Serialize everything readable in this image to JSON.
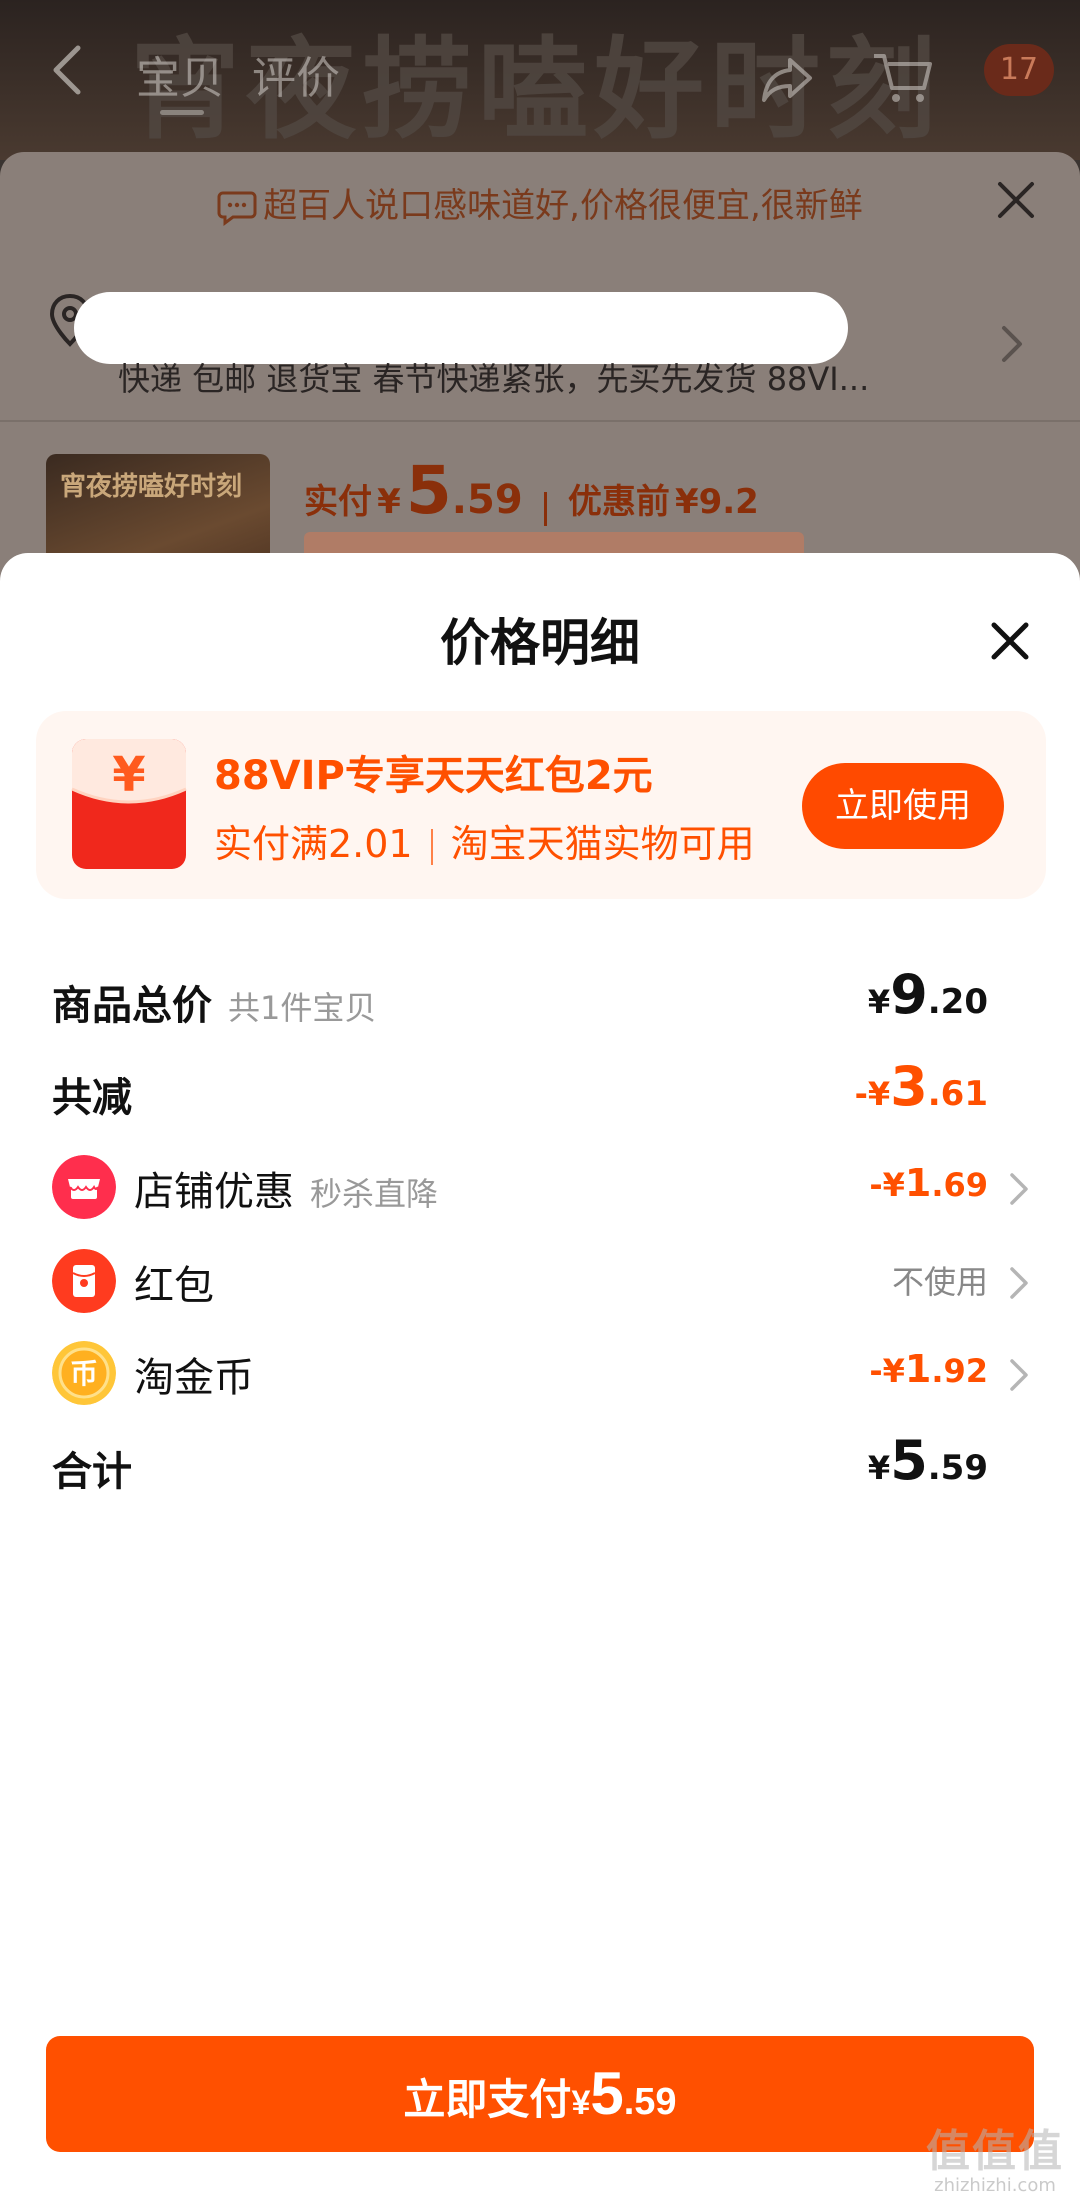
{
  "background": {
    "banner_text": "宵夜捞嗑好时刻",
    "nav": {
      "tab_baobei": "宝贝",
      "tab_pingjia": "评价",
      "cart_badge": "17"
    },
    "promo_text": "超百人说口感味道好,价格很便宜,很新鲜",
    "address_tags": "快递 包邮 退货宝 春节快递紧张，先买先发货 88VI...",
    "product_image_text": "宵夜捞嗑好时刻",
    "price": {
      "label": "实付",
      "currency": "¥",
      "int": "5",
      "dec": ".59",
      "before_label": "优惠前",
      "before_value": "¥9.2"
    }
  },
  "modal": {
    "title": "价格明细",
    "vip": {
      "title": "88VIP专享天天红包2元",
      "sub_left": "实付满2.01",
      "sub_right": "淘宝天猫实物可用",
      "button": "立即使用",
      "envelope_symbol": "¥"
    },
    "rows": {
      "total": {
        "label": "商品总价",
        "sub": "共1件宝贝",
        "cur": "¥",
        "int": "9",
        "dec": ".20"
      },
      "discount": {
        "label": "共减",
        "cur": "-¥",
        "int": "3",
        "dec": ".61"
      },
      "shop": {
        "label": "店铺优惠",
        "sub": "秒杀直降",
        "cur": "-¥",
        "int": "1",
        "dec": ".69"
      },
      "redpacket": {
        "label": "红包",
        "value": "不使用"
      },
      "coin": {
        "label": "淘金币",
        "cur": "-¥",
        "int": "1",
        "dec": ".92",
        "icon_char": "币"
      },
      "sum": {
        "label": "合计",
        "cur": "¥",
        "int": "5",
        "dec": ".59"
      }
    },
    "pay_button": {
      "label": "立即支付",
      "cur": "¥",
      "int": "5",
      "dec": ".59"
    }
  },
  "watermark": {
    "main": "值值值",
    "sub": "zhizhizhi.com"
  },
  "colors": {
    "accent": "#ff5000",
    "vip_bg": "#fff6f1",
    "shop_icon": "#ff2e4d",
    "redpacket_icon": "#ff3b1f",
    "coin_icon": "#ffb020"
  }
}
